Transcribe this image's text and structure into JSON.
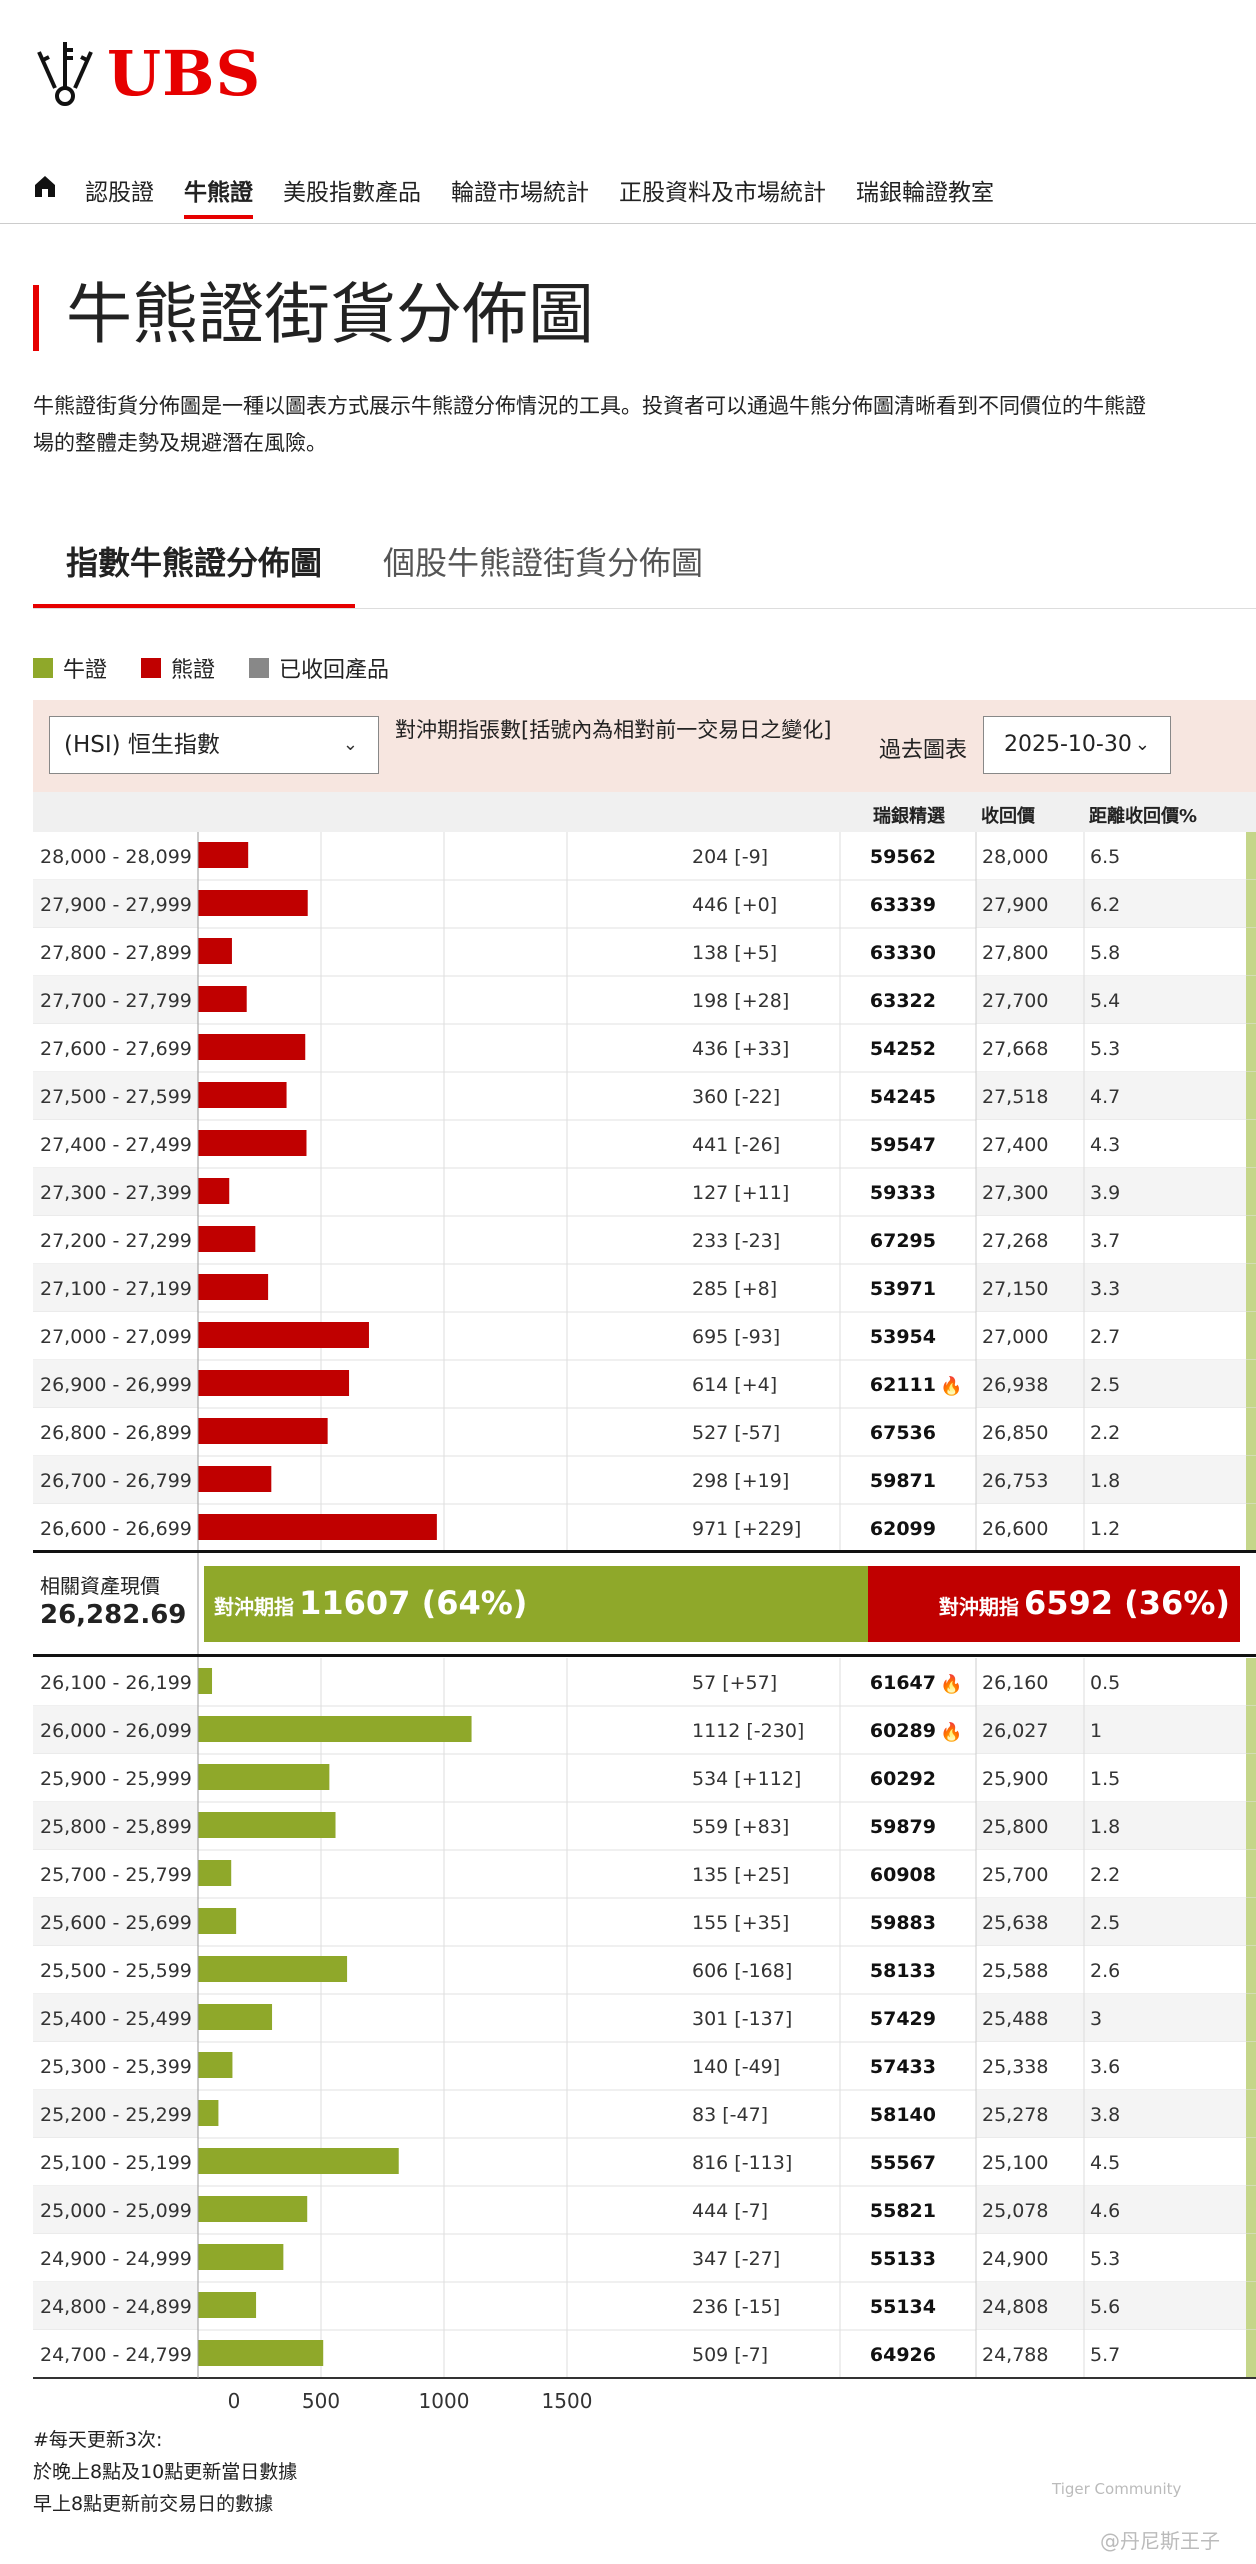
{
  "logo": {
    "text": "UBS"
  },
  "nav": {
    "items": [
      "認股證",
      "牛熊證",
      "美股指數產品",
      "輪證市場統計",
      "正股資料及市場統計",
      "瑞銀輪證教室"
    ],
    "active": 1
  },
  "page": {
    "title": "牛熊證街貨分佈圖",
    "description_line1": "牛熊證街貨分佈圖是一種以圖表方式展示牛熊證分佈情況的工具。投資者可以通過牛熊分佈圖清晰看到不同價位的牛熊證",
    "description_line2": "場的整體走勢及規避潛在風險。"
  },
  "tabs": {
    "tab1": "指數牛熊證分佈圖",
    "tab2": "個股牛熊證街貨分佈圖"
  },
  "legend": {
    "bull": "牛證",
    "bear": "熊證",
    "recalled": "已收回產品"
  },
  "controls": {
    "select_value": "(HSI) 恒生指數",
    "label": "對沖期指張數[括號內為相對前一交易日之變化]",
    "past_label": "過去圖表",
    "date_value": "2025-10-30"
  },
  "columns": {
    "pick": "瑞銀精選",
    "call_price": "收回價",
    "distance": "距離收回價%"
  },
  "summary": {
    "asset_label": "相關資產現價",
    "asset_value": "26,282.69",
    "bull_label": "對沖期指",
    "bull_value": "11607 (64%)",
    "bear_label": "對沖期指",
    "bear_value": "6592 (36%)"
  },
  "colors": {
    "bull": "#8fa82a",
    "bear": "#c00000",
    "recalled": "#888888",
    "accent": "#e60000"
  },
  "chart_data": {
    "type": "bar",
    "orientation": "horizontal",
    "xlim": [
      0,
      1500
    ],
    "xticks": [
      0,
      500,
      1000,
      1500
    ],
    "bear": {
      "categories": [
        "28,000 - 28,099",
        "27,900 - 27,999",
        "27,800 - 27,899",
        "27,700 - 27,799",
        "27,600 - 27,699",
        "27,500 - 27,599",
        "27,400 - 27,499",
        "27,300 - 27,399",
        "27,200 - 27,299",
        "27,100 - 27,199",
        "27,000 - 27,099",
        "26,900 - 26,999",
        "26,800 - 26,899",
        "26,700 - 26,799",
        "26,600 - 26,699"
      ],
      "values": [
        204,
        446,
        138,
        198,
        436,
        360,
        441,
        127,
        233,
        285,
        695,
        614,
        527,
        298,
        971
      ],
      "value_labels": [
        "204 [-9]",
        "446 [+0]",
        "138 [+5]",
        "198 [+28]",
        "436 [+33]",
        "360 [-22]",
        "441 [-26]",
        "127 [+11]",
        "233 [-23]",
        "285 [+8]",
        "695 [-93]",
        "614 [+4]",
        "527 [-57]",
        "298 [+19]",
        "971 [+229]"
      ],
      "picks": [
        "59562",
        "63339",
        "63330",
        "63322",
        "54252",
        "54245",
        "59547",
        "59333",
        "67295",
        "53971",
        "53954",
        "62111",
        "67536",
        "59871",
        "62099"
      ],
      "hot": [
        false,
        false,
        false,
        false,
        false,
        false,
        false,
        false,
        false,
        false,
        false,
        true,
        false,
        false,
        false
      ],
      "call_prices": [
        "28,000",
        "27,900",
        "27,800",
        "27,700",
        "27,668",
        "27,518",
        "27,400",
        "27,300",
        "27,268",
        "27,150",
        "27,000",
        "26,938",
        "26,850",
        "26,753",
        "26,600"
      ],
      "distances": [
        "6.5",
        "6.2",
        "5.8",
        "5.4",
        "5.3",
        "4.7",
        "4.3",
        "3.9",
        "3.7",
        "3.3",
        "2.7",
        "2.5",
        "2.2",
        "1.8",
        "1.2"
      ]
    },
    "bull": {
      "categories": [
        "26,100 - 26,199",
        "26,000 - 26,099",
        "25,900 - 25,999",
        "25,800 - 25,899",
        "25,700 - 25,799",
        "25,600 - 25,699",
        "25,500 - 25,599",
        "25,400 - 25,499",
        "25,300 - 25,399",
        "25,200 - 25,299",
        "25,100 - 25,199",
        "25,000 - 25,099",
        "24,900 - 24,999",
        "24,800 - 24,899",
        "24,700 - 24,799"
      ],
      "values": [
        57,
        1112,
        534,
        559,
        135,
        155,
        606,
        301,
        140,
        83,
        816,
        444,
        347,
        236,
        509
      ],
      "value_labels": [
        "57 [+57]",
        "1112 [-230]",
        "534 [+112]",
        "559 [+83]",
        "135 [+25]",
        "155 [+35]",
        "606 [-168]",
        "301 [-137]",
        "140 [-49]",
        "83 [-47]",
        "816 [-113]",
        "444 [-7]",
        "347 [-27]",
        "236 [-15]",
        "509 [-7]"
      ],
      "picks": [
        "61647",
        "60289",
        "60292",
        "59879",
        "60908",
        "59883",
        "58133",
        "57429",
        "57433",
        "58140",
        "55567",
        "55821",
        "55133",
        "55134",
        "64926"
      ],
      "hot": [
        true,
        true,
        false,
        false,
        false,
        false,
        false,
        false,
        false,
        false,
        false,
        false,
        false,
        false,
        false
      ],
      "call_prices": [
        "26,160",
        "26,027",
        "25,900",
        "25,800",
        "25,700",
        "25,638",
        "25,588",
        "25,488",
        "25,338",
        "25,278",
        "25,100",
        "25,078",
        "24,900",
        "24,808",
        "24,788"
      ],
      "distances": [
        "0.5",
        "1",
        "1.5",
        "1.8",
        "2.2",
        "2.5",
        "2.6",
        "3",
        "3.6",
        "3.8",
        "4.5",
        "4.6",
        "5.3",
        "5.6",
        "5.7"
      ]
    }
  },
  "footer": {
    "line1": "#每天更新3次:",
    "line2": "於晚上8點及10點更新當日數據",
    "line3": "早上8點更新前交易日的數據"
  },
  "watermark": {
    "text1": "Tiger Community",
    "text2": "@丹尼斯王子"
  }
}
